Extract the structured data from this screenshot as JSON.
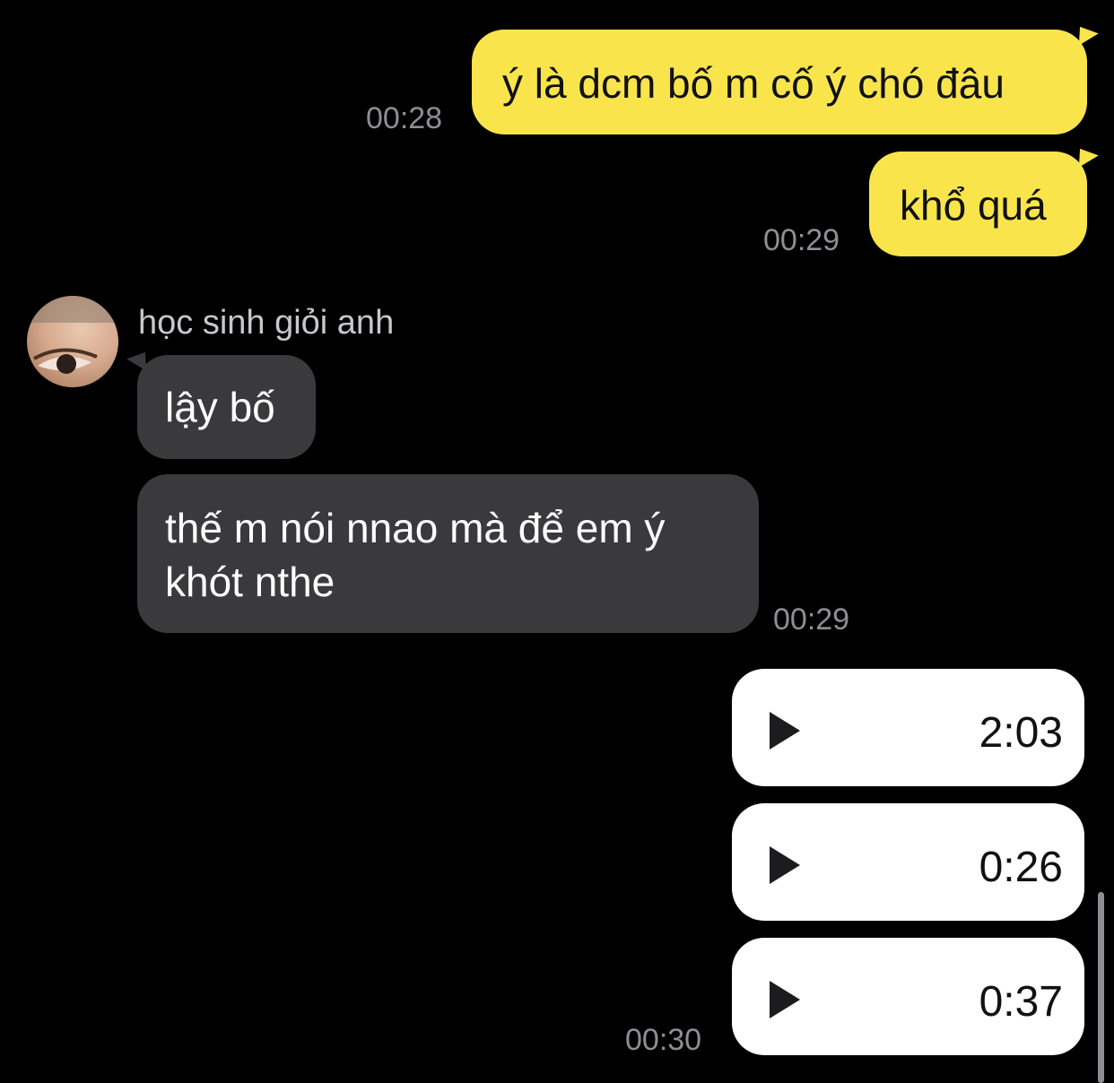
{
  "conversation": {
    "messages": [
      {
        "direction": "outgoing",
        "text": "ý là dcm bố m cố ý chó đâu",
        "time": "00:28"
      },
      {
        "direction": "outgoing",
        "text": "khổ quá",
        "time": "00:29"
      },
      {
        "direction": "incoming",
        "text": "lậy bố"
      },
      {
        "direction": "incoming",
        "text_line1": "thế m nói nnao mà để em ý",
        "text_line2": "khót nthe",
        "time": "00:29"
      }
    ],
    "sender_name": "học sinh giỏi anh",
    "voice_messages": [
      {
        "duration": "2:03"
      },
      {
        "duration": "0:26"
      },
      {
        "duration": "0:37"
      }
    ],
    "voice_time": "00:30"
  },
  "colors": {
    "outgoing_bubble": "#F9E54B",
    "incoming_bubble": "#3A3A3C",
    "voice_bubble": "#FFFFFF",
    "background": "#000000",
    "timestamp": "#8E8E93"
  },
  "icons": [
    "play-icon",
    "avatar"
  ]
}
